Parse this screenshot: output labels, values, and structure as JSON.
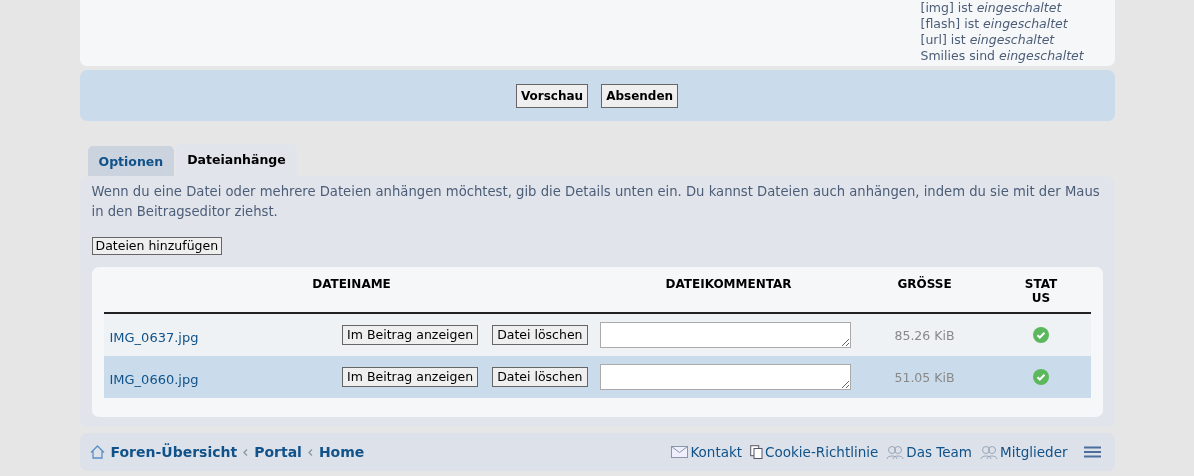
{
  "bbcode_status": [
    {
      "tag": "[img]",
      "text": "ist",
      "state": "eingeschaltet"
    },
    {
      "tag": "[flash]",
      "text": "ist",
      "state": "eingeschaltet"
    },
    {
      "tag": "[url]",
      "text": "ist",
      "state": "eingeschaltet"
    },
    {
      "tag": "Smilies",
      "text": "sind",
      "state": "eingeschaltet"
    }
  ],
  "submit_buttons": [
    "Vorschau",
    "Absenden"
  ],
  "tabs": [
    {
      "label": "Optionen",
      "selected": false
    },
    {
      "label": "Dateianhänge",
      "selected": true
    }
  ],
  "attachments": {
    "intro": "Wenn du eine Datei oder mehrere Dateien anhängen möchtest, gib die Details unten ein. Du kannst Dateien auch anhängen, indem du sie mit der Maus in den Beitragseditor ziehst.",
    "add_button": "Dateien hinzufügen",
    "columns": [
      "DATEINAME",
      "DATEIKOMMENTAR",
      "GRÖSSE",
      "STAT US"
    ],
    "rows": [
      {
        "filename": "IMG_0637.jpg",
        "show_button": "Im Beitrag anzeigen",
        "delete_button": "Datei löschen",
        "size": "85.26 KiB",
        "uploaded": true,
        "selected": false
      },
      {
        "filename": "IMG_0660.jpg",
        "show_button": "Im Beitrag anzeigen",
        "delete_button": "Datei löschen",
        "size": "51.05 KiB",
        "uploaded": true,
        "selected": true
      }
    ]
  },
  "breadcrumbs": [
    "Foren-Übersicht",
    "Portal",
    "Home"
  ],
  "footer_links": [
    {
      "label": "Kontakt",
      "kind": "mail"
    },
    {
      "label": "Cookie-Richtlinie",
      "kind": "pages"
    },
    {
      "label": "Das Team",
      "kind": "team"
    },
    {
      "label": "Mitglieder",
      "kind": "team"
    }
  ]
}
